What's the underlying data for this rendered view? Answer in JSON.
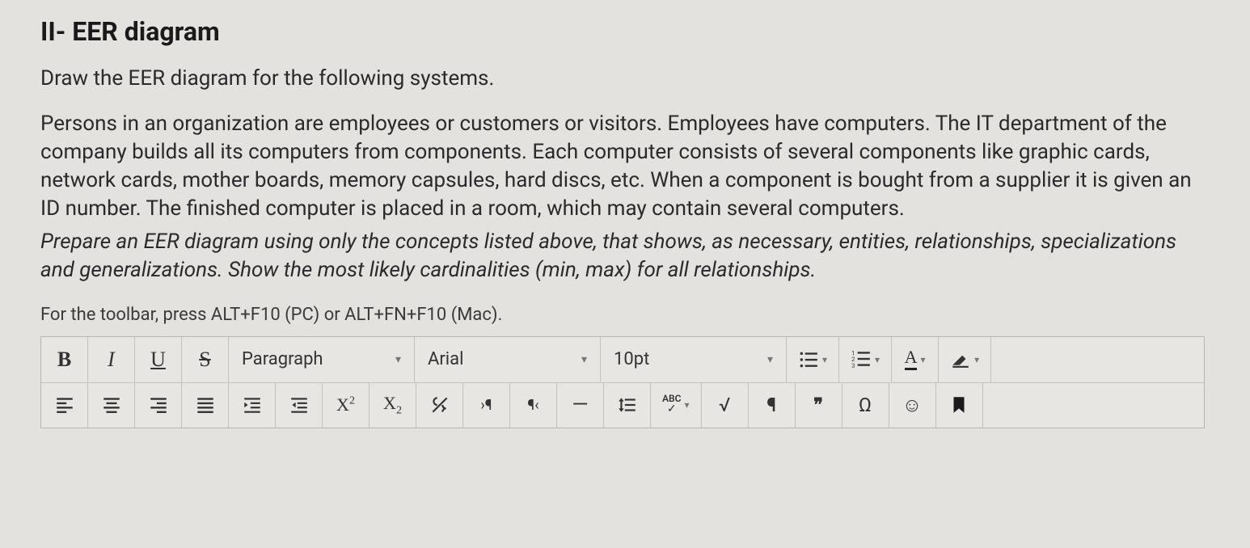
{
  "heading": "II-    EER diagram",
  "intro": "Draw the EER diagram for the following systems.",
  "body1": "Persons in an organization are employees or customers or visitors. Employees have computers. The IT department of the company builds all its computers from components. Each computer consists of several components like graphic cards, network cards, mother boards, memory capsules, hard discs, etc. When a component is bought from a supplier it is given an ID number. The finished computer is placed in a room, which may contain several computers.",
  "body2": "Prepare an EER diagram using only the concepts listed above, that shows, as necessary, entities, relationships, specializations and generalizations. Show the most likely cardinalities (min, max) for all relationships.",
  "hint": "For the toolbar, press ALT+F10 (PC) or ALT+FN+F10 (Mac).",
  "toolbar": {
    "bold": "B",
    "italic": "I",
    "underline": "U",
    "strike": "S",
    "paragraph": "Paragraph",
    "font": "Arial",
    "size": "10pt",
    "textcolor_glyph": "A",
    "superscript": "X",
    "subscript": "X",
    "abc": "ABC",
    "check": "✓",
    "pilcrow": "¶",
    "quotes": "❞",
    "omega": "Ω",
    "emoji": "☺",
    "dash": "—"
  }
}
